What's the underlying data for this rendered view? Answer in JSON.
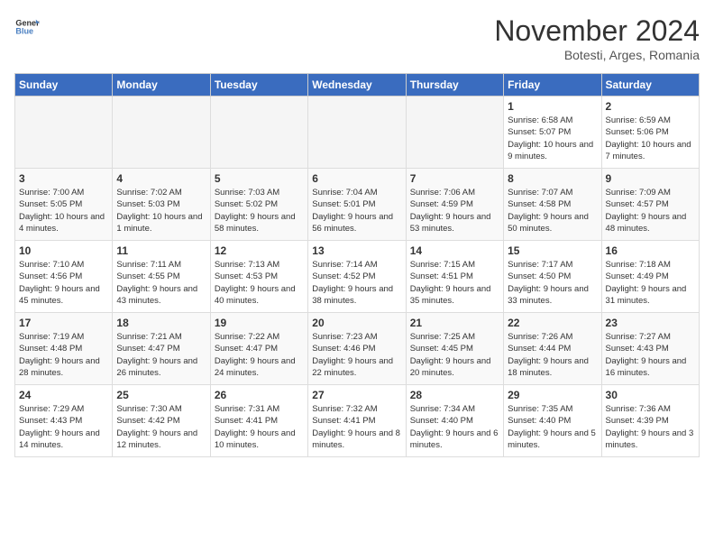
{
  "header": {
    "logo_general": "General",
    "logo_blue": "Blue",
    "month": "November 2024",
    "location": "Botesti, Arges, Romania"
  },
  "days_of_week": [
    "Sunday",
    "Monday",
    "Tuesday",
    "Wednesday",
    "Thursday",
    "Friday",
    "Saturday"
  ],
  "weeks": [
    [
      {
        "day": "",
        "info": ""
      },
      {
        "day": "",
        "info": ""
      },
      {
        "day": "",
        "info": ""
      },
      {
        "day": "",
        "info": ""
      },
      {
        "day": "",
        "info": ""
      },
      {
        "day": "1",
        "info": "Sunrise: 6:58 AM\nSunset: 5:07 PM\nDaylight: 10 hours\nand 9 minutes."
      },
      {
        "day": "2",
        "info": "Sunrise: 6:59 AM\nSunset: 5:06 PM\nDaylight: 10 hours\nand 7 minutes."
      }
    ],
    [
      {
        "day": "3",
        "info": "Sunrise: 7:00 AM\nSunset: 5:05 PM\nDaylight: 10 hours\nand 4 minutes."
      },
      {
        "day": "4",
        "info": "Sunrise: 7:02 AM\nSunset: 5:03 PM\nDaylight: 10 hours\nand 1 minute."
      },
      {
        "day": "5",
        "info": "Sunrise: 7:03 AM\nSunset: 5:02 PM\nDaylight: 9 hours\nand 58 minutes."
      },
      {
        "day": "6",
        "info": "Sunrise: 7:04 AM\nSunset: 5:01 PM\nDaylight: 9 hours\nand 56 minutes."
      },
      {
        "day": "7",
        "info": "Sunrise: 7:06 AM\nSunset: 4:59 PM\nDaylight: 9 hours\nand 53 minutes."
      },
      {
        "day": "8",
        "info": "Sunrise: 7:07 AM\nSunset: 4:58 PM\nDaylight: 9 hours\nand 50 minutes."
      },
      {
        "day": "9",
        "info": "Sunrise: 7:09 AM\nSunset: 4:57 PM\nDaylight: 9 hours\nand 48 minutes."
      }
    ],
    [
      {
        "day": "10",
        "info": "Sunrise: 7:10 AM\nSunset: 4:56 PM\nDaylight: 9 hours\nand 45 minutes."
      },
      {
        "day": "11",
        "info": "Sunrise: 7:11 AM\nSunset: 4:55 PM\nDaylight: 9 hours\nand 43 minutes."
      },
      {
        "day": "12",
        "info": "Sunrise: 7:13 AM\nSunset: 4:53 PM\nDaylight: 9 hours\nand 40 minutes."
      },
      {
        "day": "13",
        "info": "Sunrise: 7:14 AM\nSunset: 4:52 PM\nDaylight: 9 hours\nand 38 minutes."
      },
      {
        "day": "14",
        "info": "Sunrise: 7:15 AM\nSunset: 4:51 PM\nDaylight: 9 hours\nand 35 minutes."
      },
      {
        "day": "15",
        "info": "Sunrise: 7:17 AM\nSunset: 4:50 PM\nDaylight: 9 hours\nand 33 minutes."
      },
      {
        "day": "16",
        "info": "Sunrise: 7:18 AM\nSunset: 4:49 PM\nDaylight: 9 hours\nand 31 minutes."
      }
    ],
    [
      {
        "day": "17",
        "info": "Sunrise: 7:19 AM\nSunset: 4:48 PM\nDaylight: 9 hours\nand 28 minutes."
      },
      {
        "day": "18",
        "info": "Sunrise: 7:21 AM\nSunset: 4:47 PM\nDaylight: 9 hours\nand 26 minutes."
      },
      {
        "day": "19",
        "info": "Sunrise: 7:22 AM\nSunset: 4:47 PM\nDaylight: 9 hours\nand 24 minutes."
      },
      {
        "day": "20",
        "info": "Sunrise: 7:23 AM\nSunset: 4:46 PM\nDaylight: 9 hours\nand 22 minutes."
      },
      {
        "day": "21",
        "info": "Sunrise: 7:25 AM\nSunset: 4:45 PM\nDaylight: 9 hours\nand 20 minutes."
      },
      {
        "day": "22",
        "info": "Sunrise: 7:26 AM\nSunset: 4:44 PM\nDaylight: 9 hours\nand 18 minutes."
      },
      {
        "day": "23",
        "info": "Sunrise: 7:27 AM\nSunset: 4:43 PM\nDaylight: 9 hours\nand 16 minutes."
      }
    ],
    [
      {
        "day": "24",
        "info": "Sunrise: 7:29 AM\nSunset: 4:43 PM\nDaylight: 9 hours\nand 14 minutes."
      },
      {
        "day": "25",
        "info": "Sunrise: 7:30 AM\nSunset: 4:42 PM\nDaylight: 9 hours\nand 12 minutes."
      },
      {
        "day": "26",
        "info": "Sunrise: 7:31 AM\nSunset: 4:41 PM\nDaylight: 9 hours\nand 10 minutes."
      },
      {
        "day": "27",
        "info": "Sunrise: 7:32 AM\nSunset: 4:41 PM\nDaylight: 9 hours\nand 8 minutes."
      },
      {
        "day": "28",
        "info": "Sunrise: 7:34 AM\nSunset: 4:40 PM\nDaylight: 9 hours\nand 6 minutes."
      },
      {
        "day": "29",
        "info": "Sunrise: 7:35 AM\nSunset: 4:40 PM\nDaylight: 9 hours\nand 5 minutes."
      },
      {
        "day": "30",
        "info": "Sunrise: 7:36 AM\nSunset: 4:39 PM\nDaylight: 9 hours\nand 3 minutes."
      }
    ]
  ]
}
